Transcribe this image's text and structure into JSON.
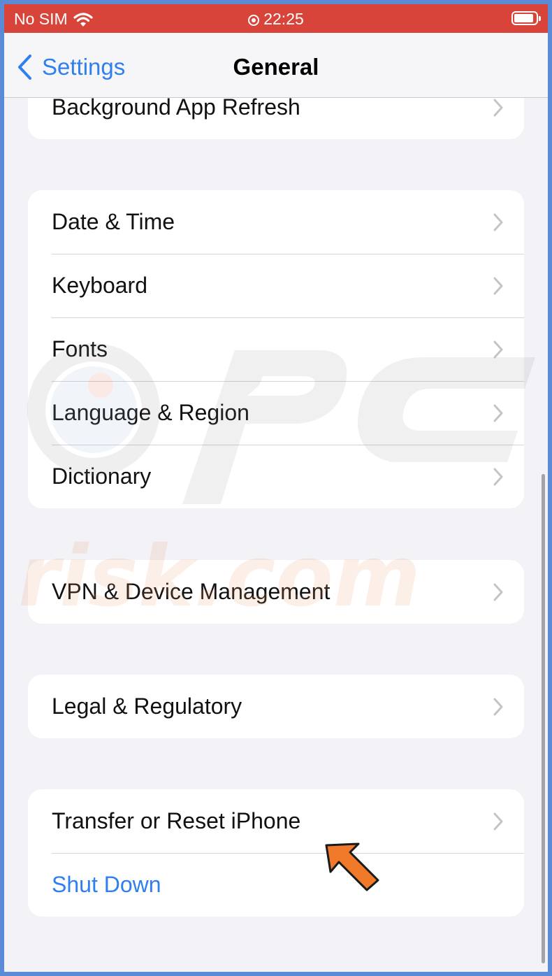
{
  "status_bar": {
    "carrier": "No SIM",
    "time": "22:25",
    "wifi_icon": "wifi-icon",
    "battery_icon": "battery-icon"
  },
  "nav": {
    "back_label": "Settings",
    "title": "General"
  },
  "groups": [
    {
      "items": [
        {
          "label": "Background App Refresh"
        }
      ]
    },
    {
      "items": [
        {
          "label": "Date & Time"
        },
        {
          "label": "Keyboard"
        },
        {
          "label": "Fonts"
        },
        {
          "label": "Language & Region"
        },
        {
          "label": "Dictionary"
        }
      ]
    },
    {
      "items": [
        {
          "label": "VPN & Device Management"
        }
      ]
    },
    {
      "items": [
        {
          "label": "Legal & Regulatory"
        }
      ]
    },
    {
      "items": [
        {
          "label": "Transfer or Reset iPhone"
        },
        {
          "label": "Shut Down"
        }
      ]
    }
  ],
  "watermark": {
    "text": "risk.com"
  },
  "colors": {
    "status_bar": "#d9443a",
    "accent": "#2f7ff0",
    "background": "#f2f2f7",
    "frame_border": "#5b8bd6",
    "pointer_arrow": "#f07a2a"
  }
}
